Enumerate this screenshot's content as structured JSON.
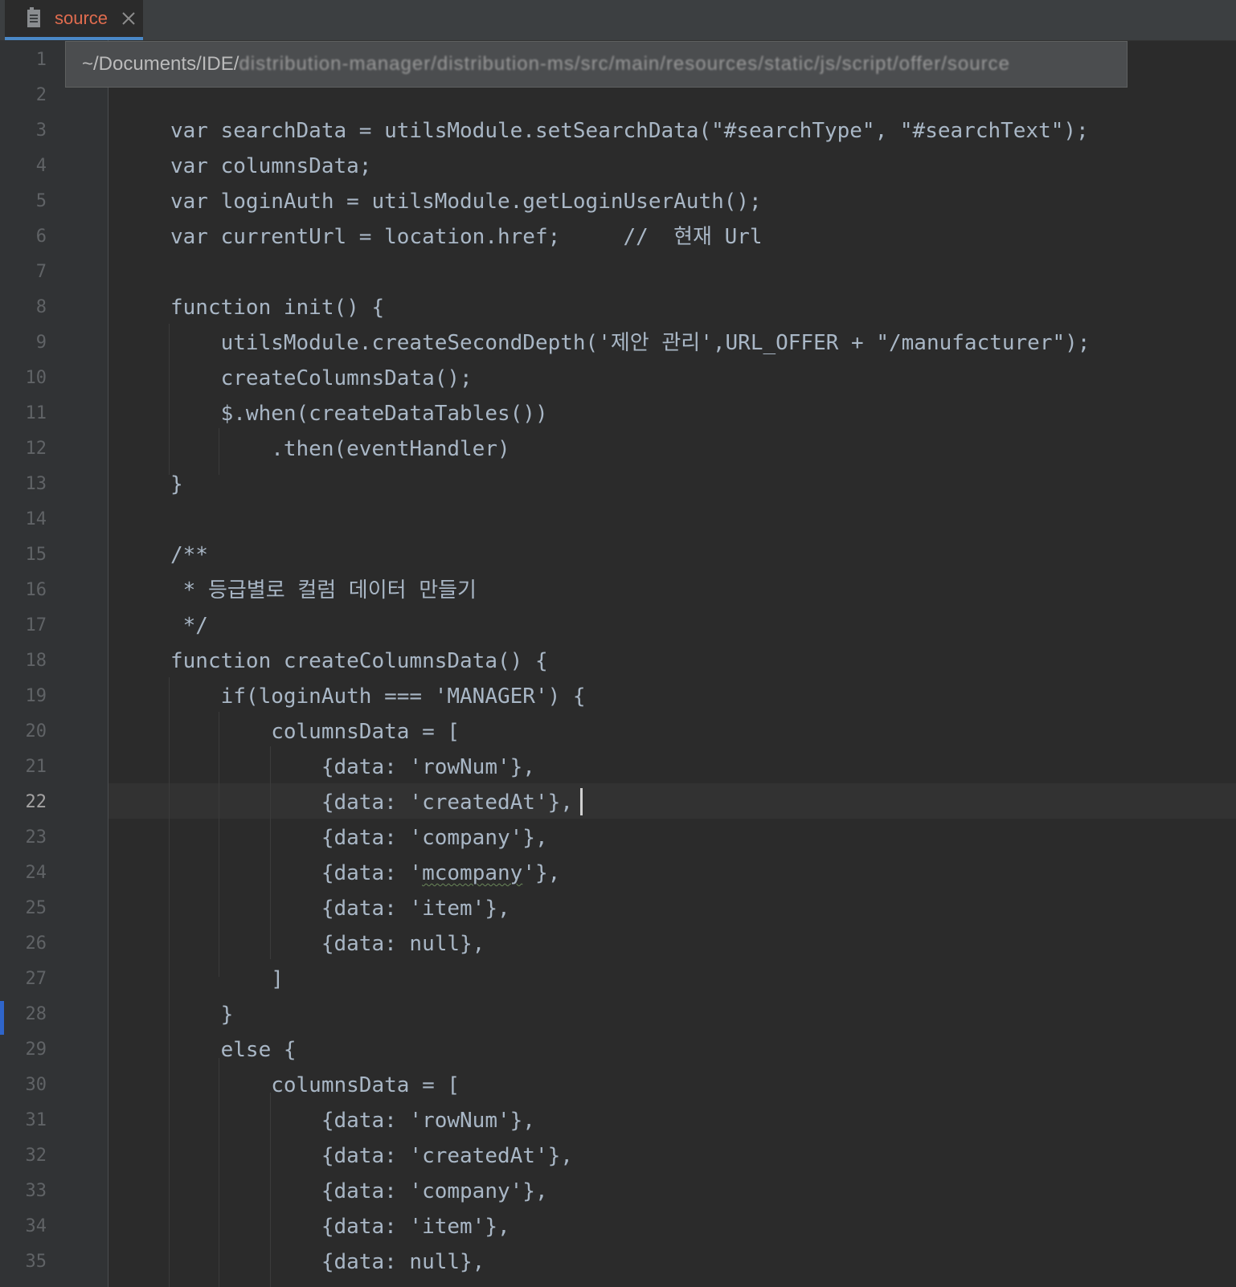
{
  "tab": {
    "label": "source",
    "icon": "file-icon",
    "close_icon": "close-icon"
  },
  "path_popup": {
    "prefix": "~/Documents/IDE/",
    "obscured": "distribution-manager/distribution-ms/src/main/resources/static/js/script/offer/source"
  },
  "editor": {
    "current_line": 22,
    "line_numbers": [
      "1",
      "2",
      "3",
      "4",
      "5",
      "6",
      "7",
      "8",
      "9",
      "10",
      "11",
      "12",
      "13",
      "14",
      "15",
      "16",
      "17",
      "18",
      "19",
      "20",
      "21",
      "22",
      "23",
      "24",
      "25",
      "26",
      "27",
      "28",
      "29",
      "30",
      "31",
      "32",
      "33",
      "34",
      "35"
    ],
    "lines": [
      "",
      "",
      "var searchData = utilsModule.setSearchData(\"#searchType\", \"#searchText\");",
      "var columnsData;",
      "var loginAuth = utilsModule.getLoginUserAuth();",
      "var currentUrl = location.href;     //  현재 Url",
      "",
      "function init() {",
      "    utilsModule.createSecondDepth('제안 관리',URL_OFFER + \"/manufacturer\");",
      "    createColumnsData();",
      "    $.when(createDataTables())",
      "        .then(eventHandler)",
      "}",
      "",
      "/**",
      " * 등급별로 컬럼 데이터 만들기",
      " */",
      "function createColumnsData() {",
      "    if(loginAuth === 'MANAGER') {",
      "        columnsData = [",
      "            {data: 'rowNum'},",
      "            {data: 'createdAt'},",
      "            {data: 'company'},",
      "            {data: 'mcompany'},",
      "            {data: 'item'},",
      "            {data: null},",
      "        ]",
      "    }",
      "    else {",
      "        columnsData = [",
      "            {data: 'rowNum'},",
      "            {data: 'createdAt'},",
      "            {data: 'company'},",
      "            {data: 'item'},",
      "            {data: null},"
    ]
  }
}
